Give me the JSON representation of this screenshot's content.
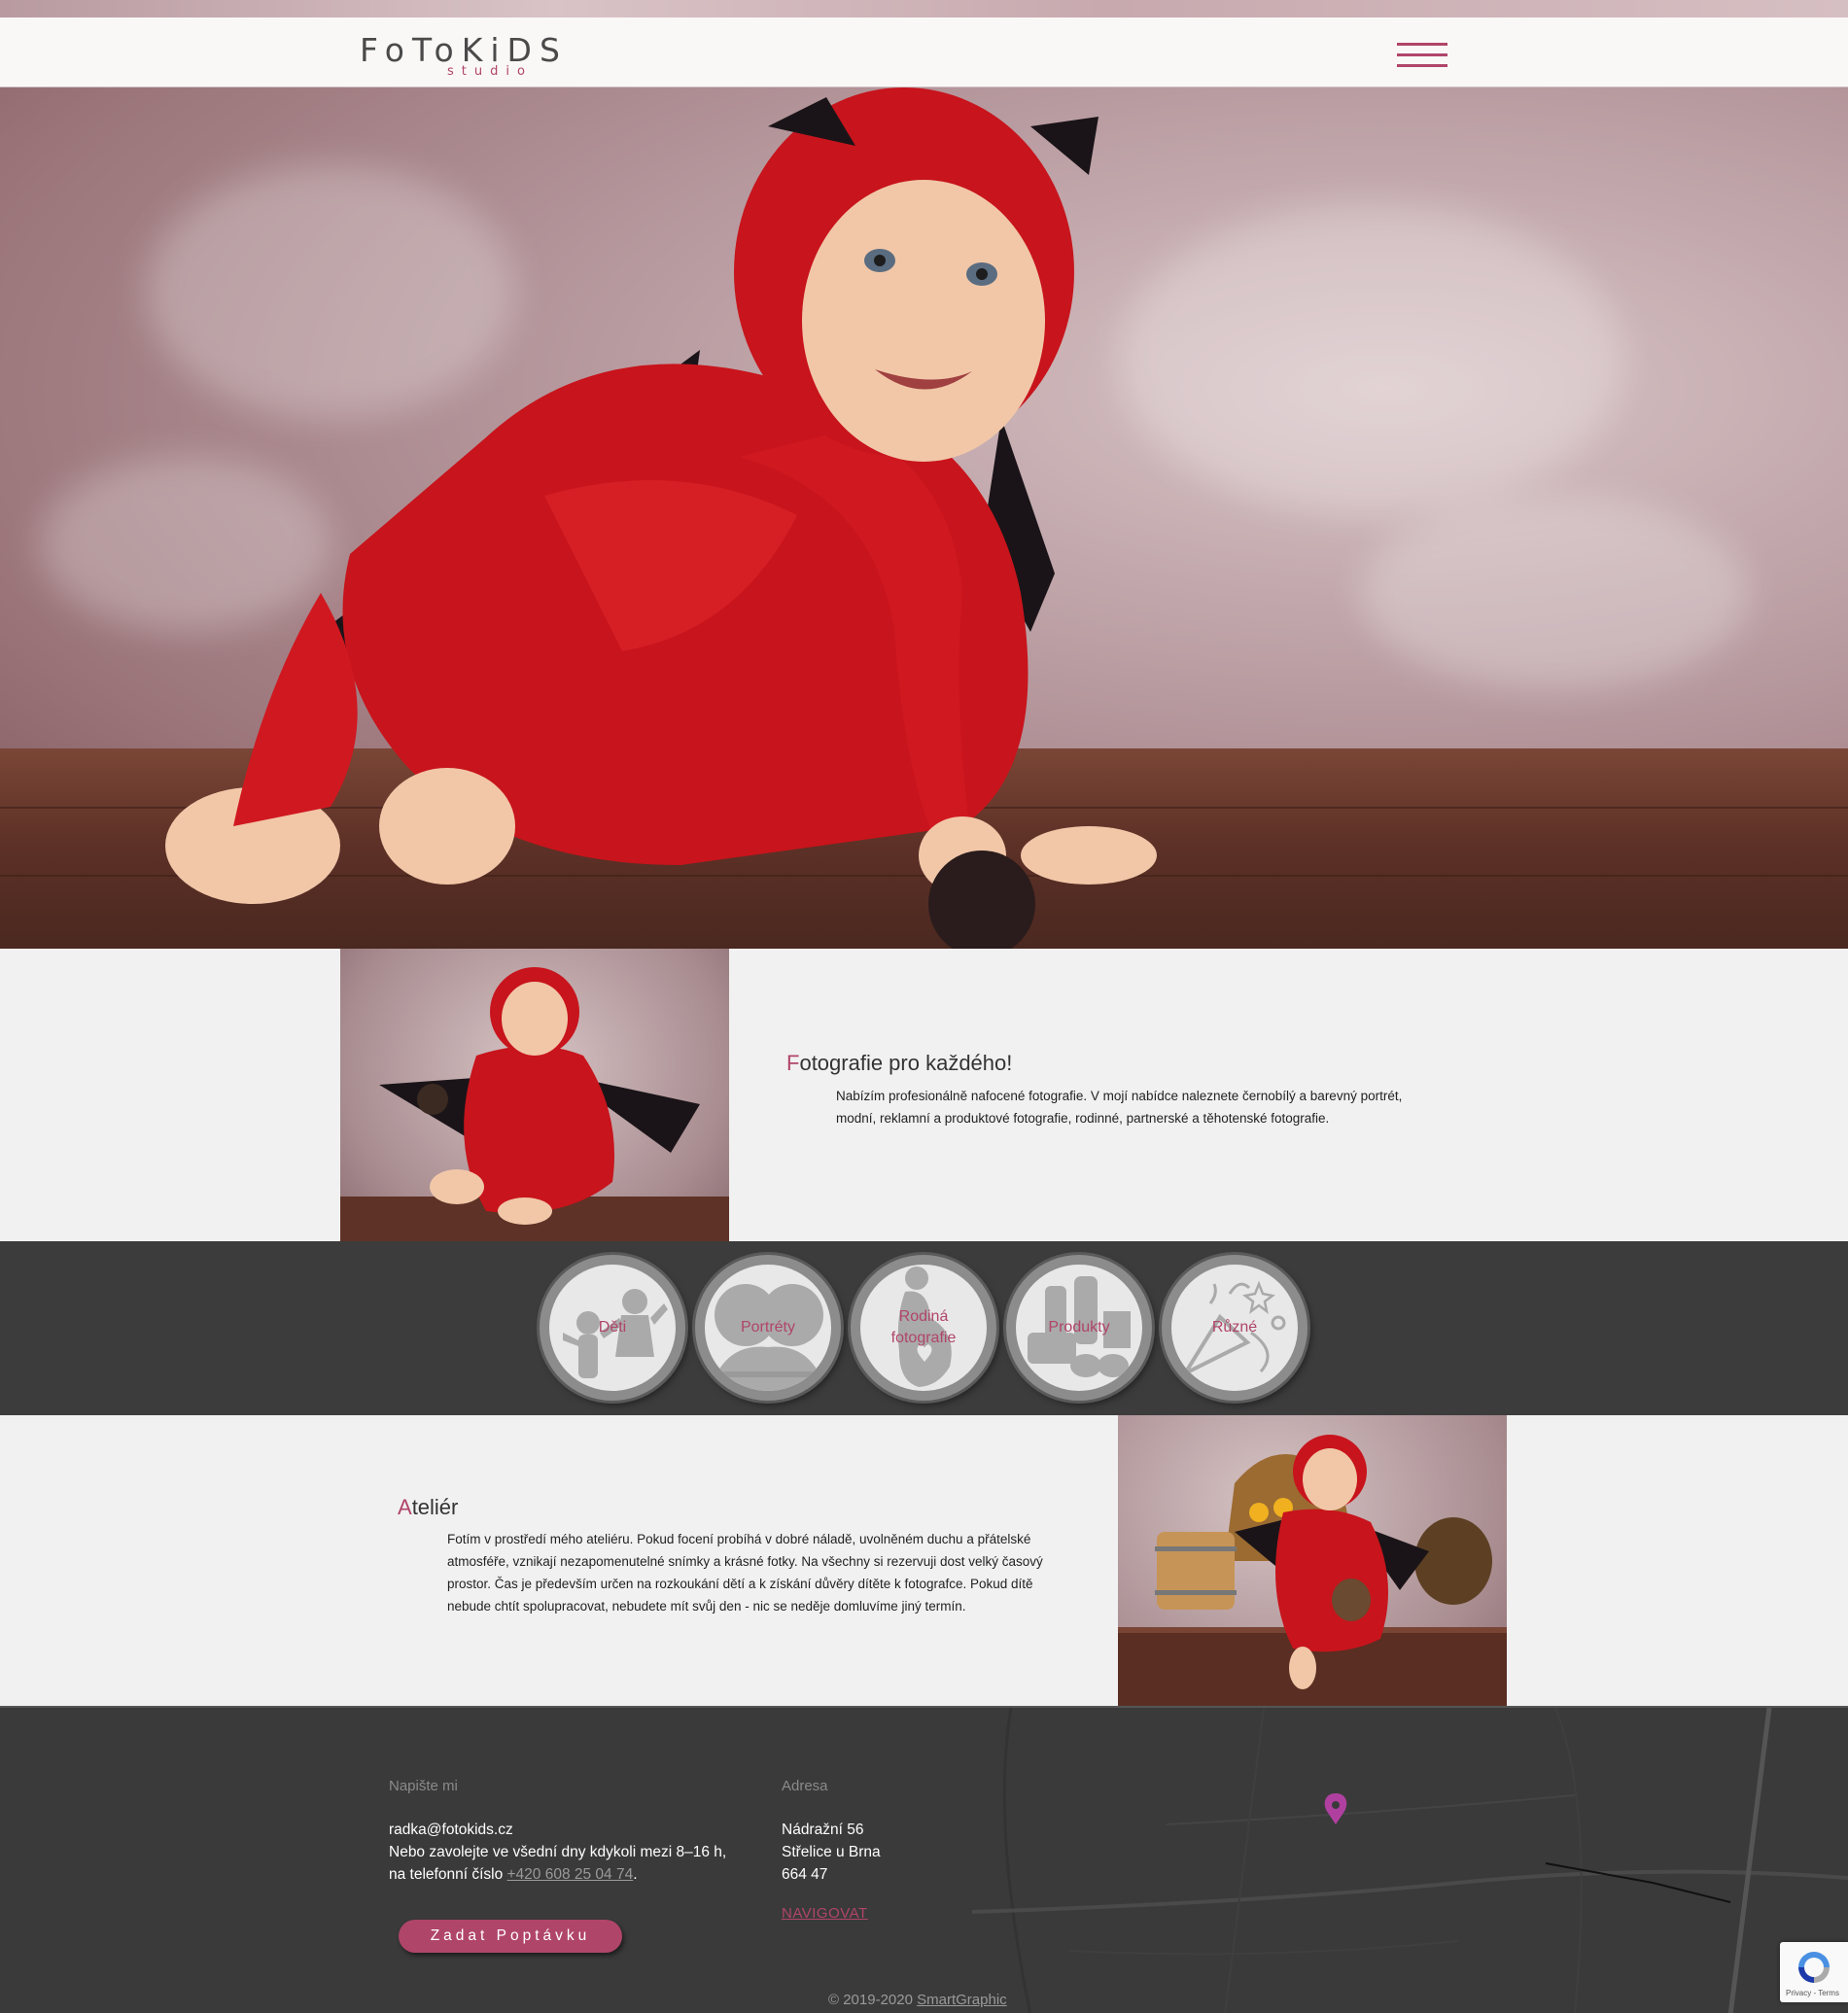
{
  "header": {
    "logo_main": "FoToKiDS",
    "logo_sub": "studio",
    "menu_icon": "hamburger-icon"
  },
  "about": {
    "heading_first": "F",
    "heading_rest": "otografie pro každého!",
    "text_line1": "Nabízím profesionálně nafocené fotografie. V mojí nabídce naleznete černobílý a barevný portrét,",
    "text_line2": "modní, reklamní a produktové fotografie, rodinné, partnerské a těhotenské fotografie."
  },
  "categories": [
    {
      "label": "Děti",
      "icon": "children-icon"
    },
    {
      "label": "Portréty",
      "icon": "portrait-icon"
    },
    {
      "label": "Rodiná fotografie",
      "label_line1": "Rodiná",
      "label_line2": "fotografie",
      "icon": "pregnancy-icon"
    },
    {
      "label": "Produkty",
      "icon": "products-icon"
    },
    {
      "label": "Různé",
      "icon": "party-icon"
    }
  ],
  "atelier": {
    "heading_first": "A",
    "heading_rest": "teliér",
    "lines": [
      "Fotím v prostředí mého ateliéru. Pokud focení probíhá v dobré náladě, uvolněném duchu a přátelské",
      "atmosféře, vznikají nezapomenutelné snímky a krásné fotky. Na všechny si rezervuji dost velký časový",
      "prostor. Čas je především určen na rozkoukání dětí a k získání důvěry dítěte k fotografce. Pokud dítě",
      "nebude chtít spolupracovat, nebudete mít svůj den - nic se neděje domluvíme jiný termín."
    ]
  },
  "footer": {
    "contact_title": "Napište mi",
    "email": "radka@fotokids.cz",
    "phone_line1": "Nebo zavolejte ve všední dny kdykoli mezi 8–16 h,",
    "phone_line2_prefix": "na telefonní číslo ",
    "phone": "+420 608 25 04 74",
    "phone_suffix": ".",
    "address_title": "Adresa",
    "street": "Nádražní 56",
    "city": "Střelice u Brna",
    "zip": "664 47",
    "navigate": "NAVIGOVAT",
    "cta": "Zadat Poptávku",
    "copyright_prefix": "© 2019-2020 ",
    "copyright_link": "SmartGraphic",
    "recaptcha": "Privacy - Terms"
  },
  "colors": {
    "accent": "#b0456a",
    "dark": "#3c3c3c",
    "light": "#f1f1f1"
  }
}
